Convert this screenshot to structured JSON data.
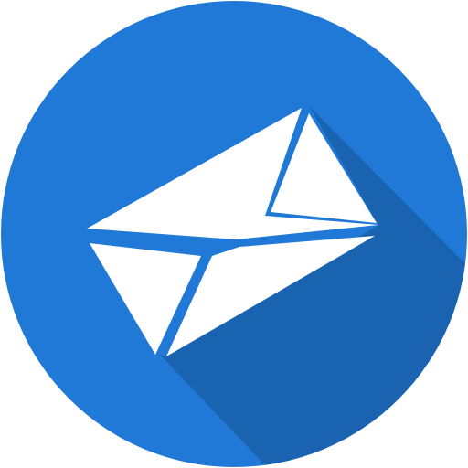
{
  "icon": {
    "name": "mail-icon",
    "colors": {
      "circle": "#2079D6",
      "shadow": "#1A63B0",
      "envelope": "#FFFFFF"
    }
  }
}
